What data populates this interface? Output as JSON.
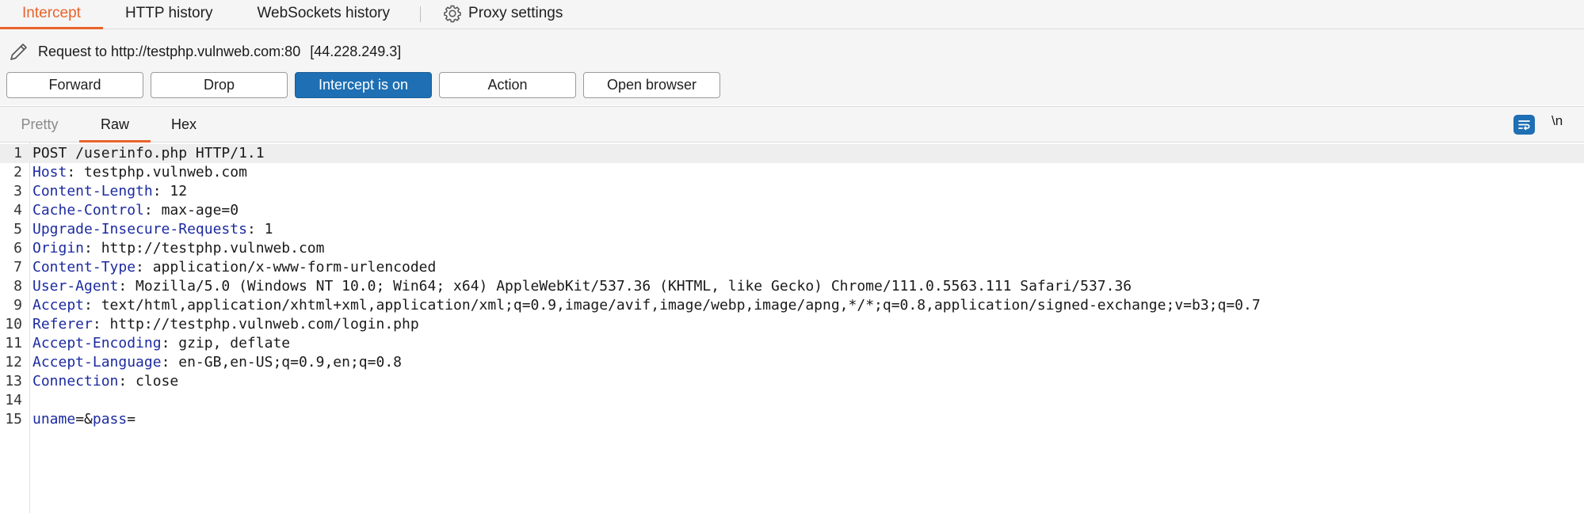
{
  "top_tabs": {
    "intercept": "Intercept",
    "http_history": "HTTP history",
    "websockets_history": "WebSockets history",
    "proxy_settings": "Proxy settings"
  },
  "request": {
    "label": "Request to http://testphp.vulnweb.com:80",
    "ip": "[44.228.249.3]"
  },
  "buttons": {
    "forward": "Forward",
    "drop": "Drop",
    "intercept": "Intercept is on",
    "action": "Action",
    "open_browser": "Open browser"
  },
  "editor_tabs": {
    "pretty": "Pretty",
    "raw": "Raw",
    "hex": "Hex",
    "newline_toggle": "\\n"
  },
  "colors": {
    "accent_orange": "#e8632b",
    "primary_blue": "#1e6fb3",
    "header_name_blue": "#1c2ba0"
  },
  "editor": {
    "lines": [
      {
        "num": "1",
        "name": "",
        "text": "POST /userinfo.php HTTP/1.1"
      },
      {
        "num": "2",
        "name": "Host",
        "text": ": testphp.vulnweb.com"
      },
      {
        "num": "3",
        "name": "Content-Length",
        "text": ": 12"
      },
      {
        "num": "4",
        "name": "Cache-Control",
        "text": ": max-age=0"
      },
      {
        "num": "5",
        "name": "Upgrade-Insecure-Requests",
        "text": ": 1"
      },
      {
        "num": "6",
        "name": "Origin",
        "text": ": http://testphp.vulnweb.com"
      },
      {
        "num": "7",
        "name": "Content-Type",
        "text": ": application/x-www-form-urlencoded"
      },
      {
        "num": "8",
        "name": "User-Agent",
        "text": ": Mozilla/5.0 (Windows NT 10.0; Win64; x64) AppleWebKit/537.36 (KHTML, like Gecko) Chrome/111.0.5563.111 Safari/537.36"
      },
      {
        "num": "9",
        "name": "Accept",
        "text": ": text/html,application/xhtml+xml,application/xml;q=0.9,image/avif,image/webp,image/apng,*/*;q=0.8,application/signed-exchange;v=b3;q=0.7"
      },
      {
        "num": "10",
        "name": "Referer",
        "text": ": http://testphp.vulnweb.com/login.php"
      },
      {
        "num": "11",
        "name": "Accept-Encoding",
        "text": ": gzip, deflate"
      },
      {
        "num": "12",
        "name": "Accept-Language",
        "text": ": en-GB,en-US;q=0.9,en;q=0.8"
      },
      {
        "num": "13",
        "name": "Connection",
        "text": ": close"
      },
      {
        "num": "14",
        "name": "",
        "text": ""
      },
      {
        "num": "15",
        "body": [
          {
            "kind": "name",
            "text": "uname"
          },
          {
            "kind": "op",
            "text": "=&"
          },
          {
            "kind": "name",
            "text": "pass"
          },
          {
            "kind": "op",
            "text": "="
          }
        ]
      }
    ]
  }
}
